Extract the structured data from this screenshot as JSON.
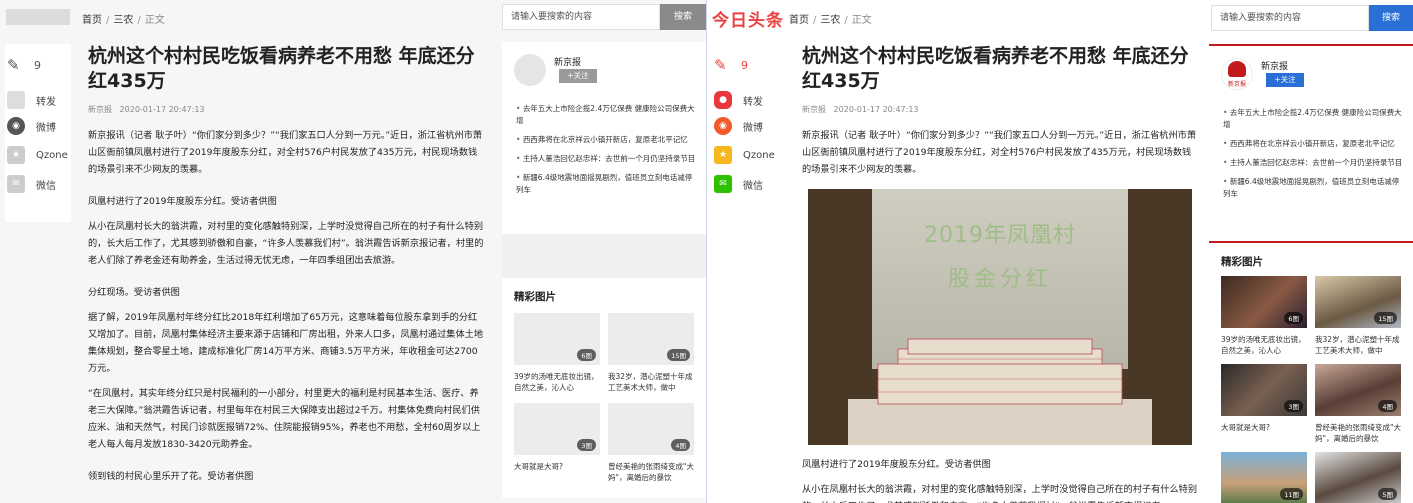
{
  "left": {
    "breadcrumb": {
      "home": "首页",
      "category": "三农",
      "current": "正文"
    },
    "search": {
      "placeholder": "请输入要搜索的内容",
      "button": "搜索"
    },
    "comment_count": "9",
    "share": [
      "转发",
      "微博",
      "Qzone",
      "微信"
    ],
    "article": {
      "title": "杭州这个村村民吃饭看病养老不用愁 年底还分红435万",
      "source": "新京报",
      "time": "2020-01-17 20:47:13",
      "paragraphs": [
        "新京报讯（记者 耿子叶）“你们家分到多少？”“我们家五口人分到一万元。”近日，浙江省杭州市萧山区衙前镇凤凰村进行了2019年度股东分红，对全村576户村民发放了435万元，村民现场数钱的场景引来不少网友的羡慕。",
        "凤凰村进行了2019年度股东分红。受访者供图",
        "从小在凤凰村长大的翁洪霞，对村里的变化感触特别深，上学时没觉得自己所在的村子有什么特别的，长大后工作了，尤其感到骄傲和自豪，“许多人羡慕我们村”。翁洪霞告诉新京报记者，村里的老人们除了养老金还有助养金，生活过得无忧无虑，一年四季组团出去旅游。",
        "分红现场。受访者供图",
        "据了解，2019年凤凰村年终分红比2018年红利增加了65万元，这意味着每位股东拿到手的分红又增加了。目前，凤凰村集体经济主要来源于店铺和厂房出租，外来人口多，凤凰村通过集体土地集体规划，整合零星土地，建成标准化厂房14万平方米、商铺3.5万平方米，年收租金可达2700万元。",
        "“在凤凰村，其实年终分红只是村民福利的一小部分，村里更大的福利是村民基本生活、医疗、养老三大保障。”翁洪霞告诉记者，村里每年在村民三大保障支出超过2千万。村集体免费向村民们供应米、油和天然气，村民门诊就医报销72%、住院能报销95%，养老也不用愁，全村60周岁以上老人每人每月发放1830-3420元助养金。",
        "领到钱的村民心里乐开了花。受访者供图"
      ]
    },
    "sidebar": {
      "source_name": "新京报",
      "follow": "+关注",
      "news": [
        "去年五大上市险企揽2.4万亿保费 健康险公司保费大增",
        "西西弗将在北京祥云小镇开新店，复原老北平记忆",
        "主持人董浩回忆赵忠祥：去世前一个月仍坚持录节目",
        "新疆6.4级地震地面摇晃剧烈，值班员立刻电话减停列车"
      ],
      "gallery_title": "精彩图片",
      "gallery": [
        {
          "badge": "6图",
          "caption": "39岁的汤唯无底妆出镜，自然之美，沁人心"
        },
        {
          "badge": "15图",
          "caption": "我32岁，潜心泥塑十年成工艺美术大师，做中"
        },
        {
          "badge": "3图",
          "caption": "大哥就是大哥?"
        },
        {
          "badge": "4图",
          "caption": "曾经美艳的张雨绮变成\"大妈\"，离婚后的暴饮"
        }
      ]
    }
  },
  "right": {
    "logo": "今日头条",
    "breadcrumb": {
      "home": "首页",
      "category": "三农",
      "current": "正文"
    },
    "search": {
      "placeholder": "请输入要搜索的内容",
      "button": "搜索"
    },
    "comment_count": "9",
    "share": [
      "转发",
      "微博",
      "Qzone",
      "微信"
    ],
    "article": {
      "title": "杭州这个村村民吃饭看病养老不用愁 年底还分红435万",
      "source": "新京报",
      "time": "2020-01-17 20:47:13",
      "para1": "新京报讯（记者 耿子叶）“你们家分到多少？”“我们家五口人分到一万元。”近日，浙江省杭州市萧山区衙前镇凤凰村进行了2019年度股东分红，对全村576户村民发放了435万元，村民现场数钱的场景引来不少网友的羡慕。",
      "photo_text": [
        "2019年凤凰村",
        "股金分红"
      ],
      "caption": "凤凰村进行了2019年度股东分红。受访者供图",
      "para2": "从小在凤凰村长大的翁洪霞，对村里的变化感触特别深，上学时没觉得自己所在的村子有什么特别的，长大后工作了，尤其感到骄傲和自豪，“许多人羡慕我们村”。翁洪霞告诉新京报记者，"
    },
    "sidebar": {
      "source_name": "新京报",
      "avatar_text": "新京报",
      "follow": "+关注",
      "news": [
        "去年五大上市险企揽2.4万亿保费 健康险公司保费大增",
        "西西弗将在北京祥云小镇开新店，复原老北平记忆",
        "主持人董浩回忆赵忠祥：去世前一个月仍坚持录节目",
        "新疆6.4级地震地面摇晃剧烈，值班员立刻电话减停列车"
      ],
      "gallery_title": "精彩图片",
      "gallery": [
        {
          "badge": "6图",
          "caption": "39岁的汤唯无底妆出镜，自然之美，沁人心"
        },
        {
          "badge": "15图",
          "caption": "我32岁，潜心泥塑十年成工艺美术大师，做中"
        },
        {
          "badge": "3图",
          "caption": "大哥就是大哥?"
        },
        {
          "badge": "4图",
          "caption": "曾经美艳的张雨绮变成\"大妈\"，离婚后的暴饮"
        },
        {
          "badge": "11图",
          "caption": ""
        },
        {
          "badge": "5图",
          "caption": ""
        }
      ]
    }
  },
  "colors": {
    "brand": "#ed4040",
    "link_blue": "#2a6fd6",
    "divider_red": "#c21b1b"
  }
}
